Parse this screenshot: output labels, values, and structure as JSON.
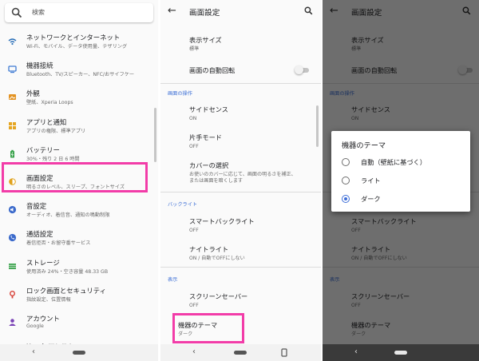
{
  "colors": {
    "accent": "#3e6ed8",
    "highlight": "#f23ca8",
    "section": "#3c6fd6"
  },
  "settings": {
    "search_label": "検索",
    "items": [
      {
        "icon": "wifi-icon",
        "title": "ネットワークとインターネット",
        "sub": "Wi-Fi、モバイル、データ使用量、テザリング",
        "color": "#2a6fb8"
      },
      {
        "icon": "devices-icon",
        "title": "機器接続",
        "sub": "Bluetooth、TV/スピーカー、NFC/おサイフケー",
        "color": "#3f7bd3"
      },
      {
        "icon": "wallpaper-icon",
        "title": "外観",
        "sub": "壁紙、Xperia Loops",
        "color": "#e39323"
      },
      {
        "icon": "apps-icon",
        "title": "アプリと通知",
        "sub": "アプリの権限、標準アプリ",
        "color": "#e5a521"
      },
      {
        "icon": "battery-icon",
        "title": "バッテリー",
        "sub": "30%・残り 2 日 6 時間",
        "color": "#3aa34c"
      },
      {
        "icon": "display-icon",
        "title": "画面設定",
        "sub": "明るさのレベル、スリープ、フォントサイズ",
        "color": "#e0a21c"
      },
      {
        "icon": "sound-icon",
        "title": "音設定",
        "sub": "オーディオ、着信音、通知の鳴動制限",
        "color": "#3b6acb"
      },
      {
        "icon": "call-icon",
        "title": "通話設定",
        "sub": "着信拒否・お留守番サービス",
        "color": "#3b6acb"
      },
      {
        "icon": "storage-icon",
        "title": "ストレージ",
        "sub": "使用済み 24%・空き容量 48.33 GB",
        "color": "#3aa34c"
      },
      {
        "icon": "lock-icon",
        "title": "ロック画面とセキュリティ",
        "sub": "指紋設定、位置情報",
        "color": "#d8453b"
      },
      {
        "icon": "account-icon",
        "title": "アカウント",
        "sub": "Google",
        "color": "#7a43b6"
      },
      {
        "icon": "xperia-icon",
        "title": "Xperiaアシスト",
        "sub": "",
        "color": "#2a6fb8"
      }
    ]
  },
  "display": {
    "title": "画面設定",
    "font_size_title": "表示サイズ",
    "font_size_sub": "標準",
    "auto_rotate": "画面の自動回転",
    "sec_ops": "画面の操作",
    "side_sense": "サイドセンス",
    "side_sense_sub": "ON",
    "one_hand": "片手モード",
    "one_hand_sub": "OFF",
    "cover": "カバーの選択",
    "cover_sub1": "お使いのカバーに応じて、画面の明るさを補正、",
    "cover_sub2": "または画面を暗くします",
    "sec_backlight": "バックライト",
    "smart_backlight": "スマートバックライト",
    "smart_backlight_sub": "OFF",
    "night_light": "ナイトライト",
    "night_light_sub": "ON / 自動でOFFにしない",
    "sec_display": "表示",
    "screensaver": "スクリーンセーバー",
    "screensaver_sub": "OFF",
    "theme": "機器のテーマ",
    "theme_sub": "ダーク"
  },
  "dialog": {
    "title": "機器のテーマ",
    "options": [
      "自動（壁紙に基づく）",
      "ライト",
      "ダーク"
    ],
    "selected_index": 2
  },
  "nav": {
    "back_glyph": "‹"
  }
}
